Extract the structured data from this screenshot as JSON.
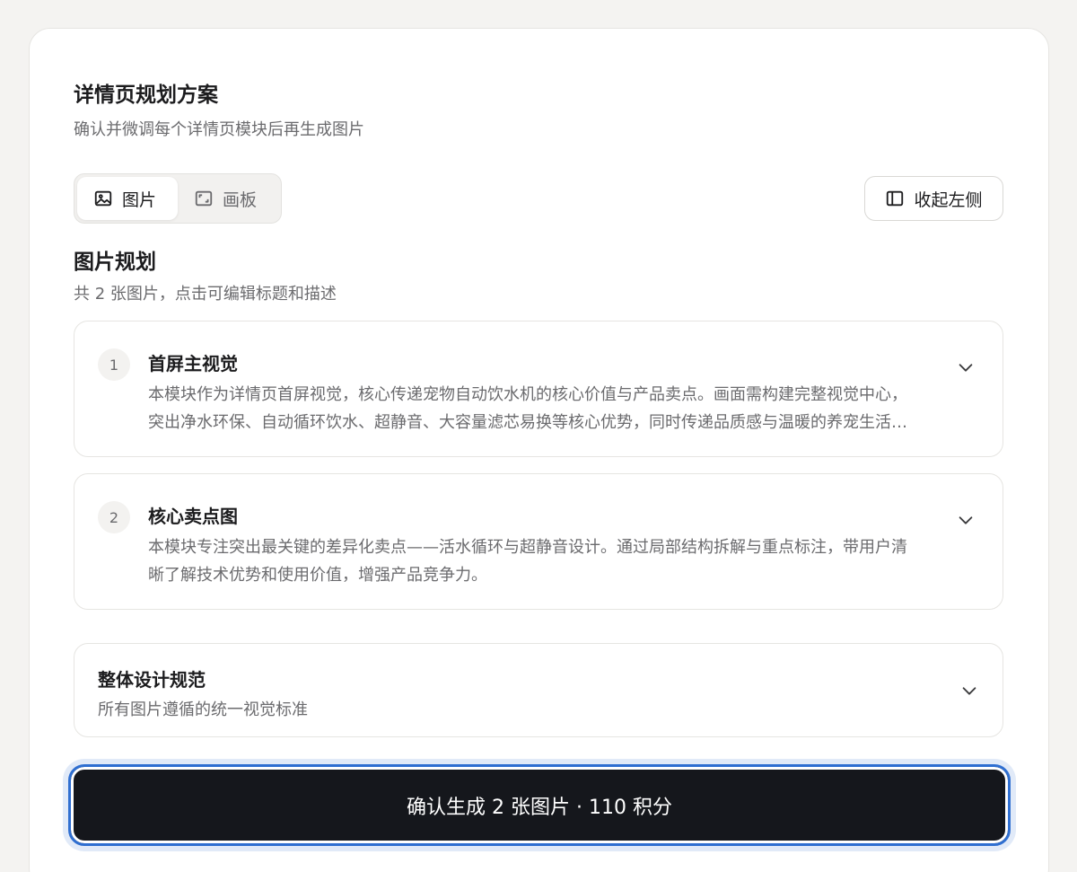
{
  "page": {
    "title": "详情页规划方案",
    "subtitle": "确认并微调每个详情页模块后再生成图片"
  },
  "view_tabs": [
    {
      "label": "图片",
      "icon": "image-icon",
      "active": true
    },
    {
      "label": "画板",
      "icon": "artboard-icon",
      "active": false
    }
  ],
  "collapse_button": {
    "label": "收起左侧",
    "icon": "sidebar-panel-icon"
  },
  "plan": {
    "title": "图片规划",
    "subtitle": "共 2 张图片，点击可编辑标题和描述",
    "items": [
      {
        "number": "1",
        "title": "首屏主视觉",
        "description": "本模块作为详情页首屏视觉，核心传递宠物自动饮水机的核心价值与产品卖点。画面需构建完整视觉中心，突出净水环保、自动循环饮水、超静音、大容量滤芯易换等核心优势，同时传递品质感与温暖的养宠生活氛围。"
      },
      {
        "number": "2",
        "title": "核心卖点图",
        "description": "本模块专注突出最关键的差异化卖点——活水循环与超静音设计。通过局部结构拆解与重点标注，带用户清晰了解技术优势和使用价值，增强产品竞争力。"
      }
    ]
  },
  "design_spec": {
    "title": "整体设计规范",
    "subtitle": "所有图片遵循的统一视觉标准"
  },
  "confirm_button": {
    "label": "确认生成 2 张图片 · 110 积分"
  },
  "colors": {
    "accent": "#2f6fd1",
    "button_bg": "#15171c",
    "page_bg": "#f4f3f1"
  }
}
